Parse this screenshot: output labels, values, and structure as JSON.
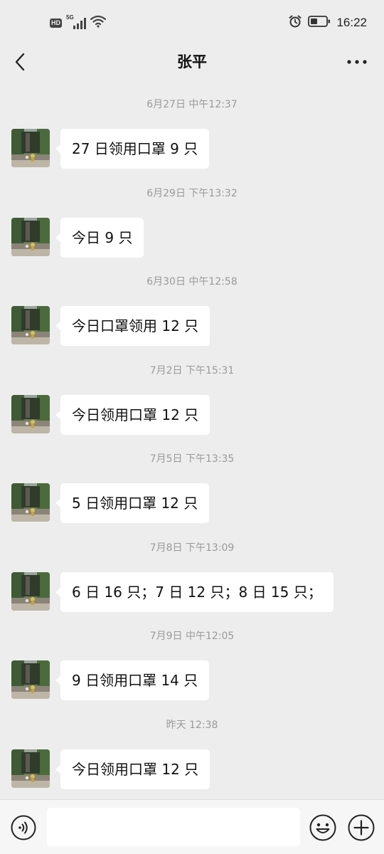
{
  "status_bar": {
    "badge": "HD",
    "network": "5G",
    "time": "16:22"
  },
  "header": {
    "title": "张平"
  },
  "messages": [
    {
      "timestamp": "6月27日 中午12:37",
      "text": "27 日领用口罩 9 只"
    },
    {
      "timestamp": "6月29日 下午13:32",
      "text": "今日 9 只"
    },
    {
      "timestamp": "6月30日 中午12:58",
      "text": "今日口罩领用 12 只"
    },
    {
      "timestamp": "7月2日 下午15:31",
      "text": "今日领用口罩 12 只"
    },
    {
      "timestamp": "7月5日 下午13:35",
      "text": "5 日领用口罩 12 只"
    },
    {
      "timestamp": "7月8日 下午13:09",
      "text": "6 日 16 只；7 日 12 只；8 日 15 只；"
    },
    {
      "timestamp": "7月9日 中午12:05",
      "text": "9 日领用口罩 14 只"
    },
    {
      "timestamp": "昨天 12:38",
      "text": "今日领用口罩 12 只"
    }
  ],
  "input_bar": {
    "value": "",
    "placeholder": ""
  },
  "icons": {
    "back": "chevron-left-icon",
    "more": "more-dots-icon",
    "voice": "voice-icon",
    "emoji": "emoji-icon",
    "plus": "plus-icon",
    "avatar": "contact-avatar"
  },
  "colors": {
    "background": "#ededed",
    "bubble": "#ffffff",
    "timestamp": "#9a9a9a",
    "input_bar": "#f6f6f6"
  }
}
